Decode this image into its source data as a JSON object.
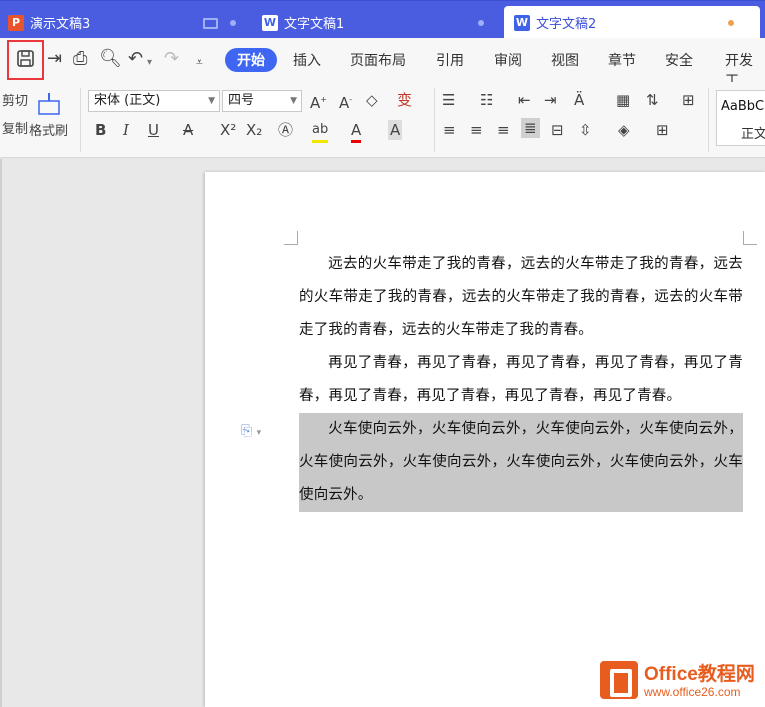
{
  "tabs": [
    {
      "label": "演示文稿3",
      "icon": "P"
    },
    {
      "label": "文字文稿1",
      "icon": "W"
    },
    {
      "label": "文字文稿2",
      "icon": "W"
    }
  ],
  "menu": {
    "active": "开始",
    "items": [
      "插入",
      "页面布局",
      "引用",
      "审阅",
      "视图",
      "章节",
      "安全",
      "开发工"
    ]
  },
  "toolbar": {
    "cut": "剪切",
    "copy": "复制",
    "format_painter": "格式刷",
    "font_name": "宋体 (正文)",
    "font_size": "四号",
    "style_preview": "AaBbC",
    "style_name": "正文"
  },
  "document": {
    "paragraphs": [
      "远去的火车带走了我的青春，远去的火车带走了我的青春，远去的火车带走了我的青春，远去的火车带走了我的青春，远去的火车带走了我的青春，远去的火车带走了我的青春。",
      "再见了青春，再见了青春，再见了青春，再见了青春，再见了青春，再见了青春，再见了青春，再见了青春，再见了青春。",
      "火车使向云外，火车使向云外，火车使向云外，火车使向云外，火车使向云外，火车使向云外，火车使向云外，火车使向云外，火车使向云外。"
    ]
  },
  "watermark": {
    "line1": "Office教程网",
    "line2": "www.office26.com"
  },
  "colors": {
    "tab_bar": "#4a5de0",
    "accent": "#3e66f3",
    "highlight_box": "#e8383d",
    "selection": "#c8c8c8"
  }
}
